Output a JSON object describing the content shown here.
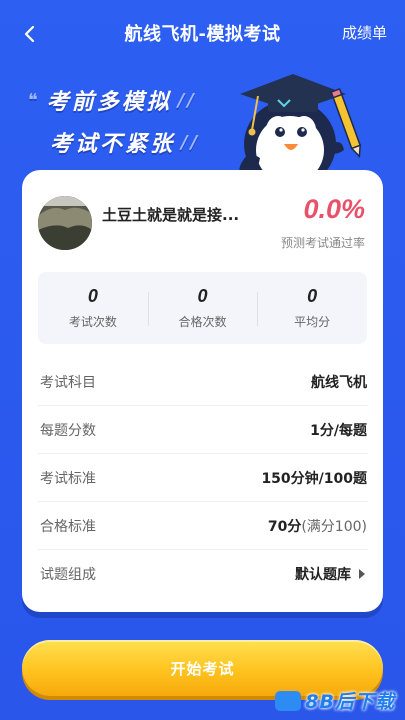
{
  "header": {
    "title": "航线飞机-模拟考试",
    "score_link": "成绩单"
  },
  "slogan": {
    "line1": "考前多模拟",
    "line2": "考试不紧张"
  },
  "profile": {
    "username": "土豆土就是就是接...",
    "pass_rate": "0.0%",
    "pass_rate_label": "预测考试通过率"
  },
  "stats": [
    {
      "value": "0",
      "label": "考试次数"
    },
    {
      "value": "0",
      "label": "合格次数"
    },
    {
      "value": "0",
      "label": "平均分"
    }
  ],
  "info": {
    "subject": {
      "label": "考试科目",
      "value": "航线飞机"
    },
    "per_question": {
      "label": "每题分数",
      "value": "1分/每题"
    },
    "standard": {
      "label": "考试标准",
      "value": "150分钟/100题"
    },
    "pass_standard": {
      "label": "合格标准",
      "value": "70分",
      "sub": "(满分100)"
    },
    "composition": {
      "label": "试题组成",
      "value": "默认题库"
    }
  },
  "start_button": "开始考试",
  "watermark": "8B后下载",
  "colors": {
    "background": "#2f63f0",
    "rate": "#e8516a",
    "button": "#ffc31f"
  }
}
